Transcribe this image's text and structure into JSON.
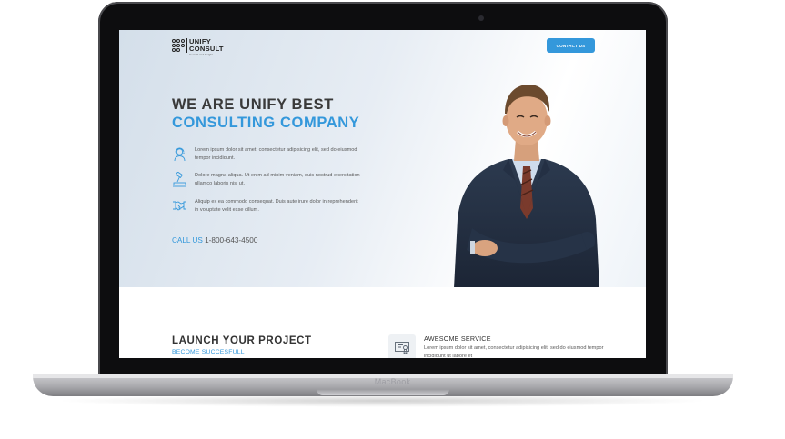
{
  "device": {
    "brand_label": "MacBook"
  },
  "site": {
    "logo": {
      "name_line1": "UNIFY",
      "name_line2": "CONSULT",
      "tagline": "Consult and Insight"
    },
    "nav": {
      "contact_button": "CONTACT US"
    },
    "hero": {
      "headline_line1": "WE ARE UNIFY BEST",
      "headline_line2": "CONSULTING COMPANY",
      "features": [
        {
          "icon": "support-agent-icon",
          "text": "Lorem ipsum dolor sit amet, consectetur adipisicing elit, sed do eiusmod tempor incididunt."
        },
        {
          "icon": "gavel-icon",
          "text": "Dolore magna aliqua. Ut enim ad minim veniam, quis nostrud exercitation ullamco laboris nisi ut."
        },
        {
          "icon": "handshake-icon",
          "text": "Aliquip ex ea commodo consequat. Duis aute irure dolor in reprehenderit in voluptate velit esse cillum."
        }
      ],
      "call_label": "CALL US",
      "call_number": "1-800-643-4500"
    },
    "launch": {
      "title": "LAUNCH YOUR PROJECT",
      "subtitle": "BECOME SUCCESFULL"
    },
    "service": {
      "icon": "certificate-icon",
      "title": "AWESOME SERVICE",
      "text": "Lorem ipsum dolor sit amet, consectetur adipisicing elit, sed do eiusmod tempor incididunt ut labore et"
    }
  },
  "colors": {
    "accent": "#3498db",
    "heading": "#3a3a3a",
    "body_text": "#5a5a5a"
  }
}
